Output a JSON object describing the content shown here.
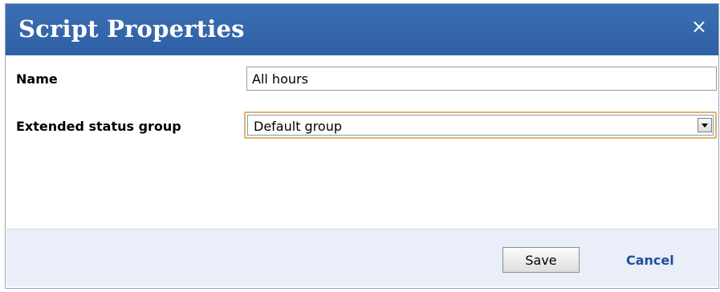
{
  "dialog": {
    "title": "Script Properties",
    "close_icon": "×"
  },
  "form": {
    "name_label": "Name",
    "name_value": "All hours",
    "group_label": "Extended status group",
    "group_selected": "Default group"
  },
  "footer": {
    "save_label": "Save",
    "cancel_label": "Cancel"
  },
  "colors": {
    "titlebar": "#3366b0",
    "footer_bg": "#e9eef8",
    "link": "#1e4f9c",
    "select_focus_border": "#e1b466"
  }
}
